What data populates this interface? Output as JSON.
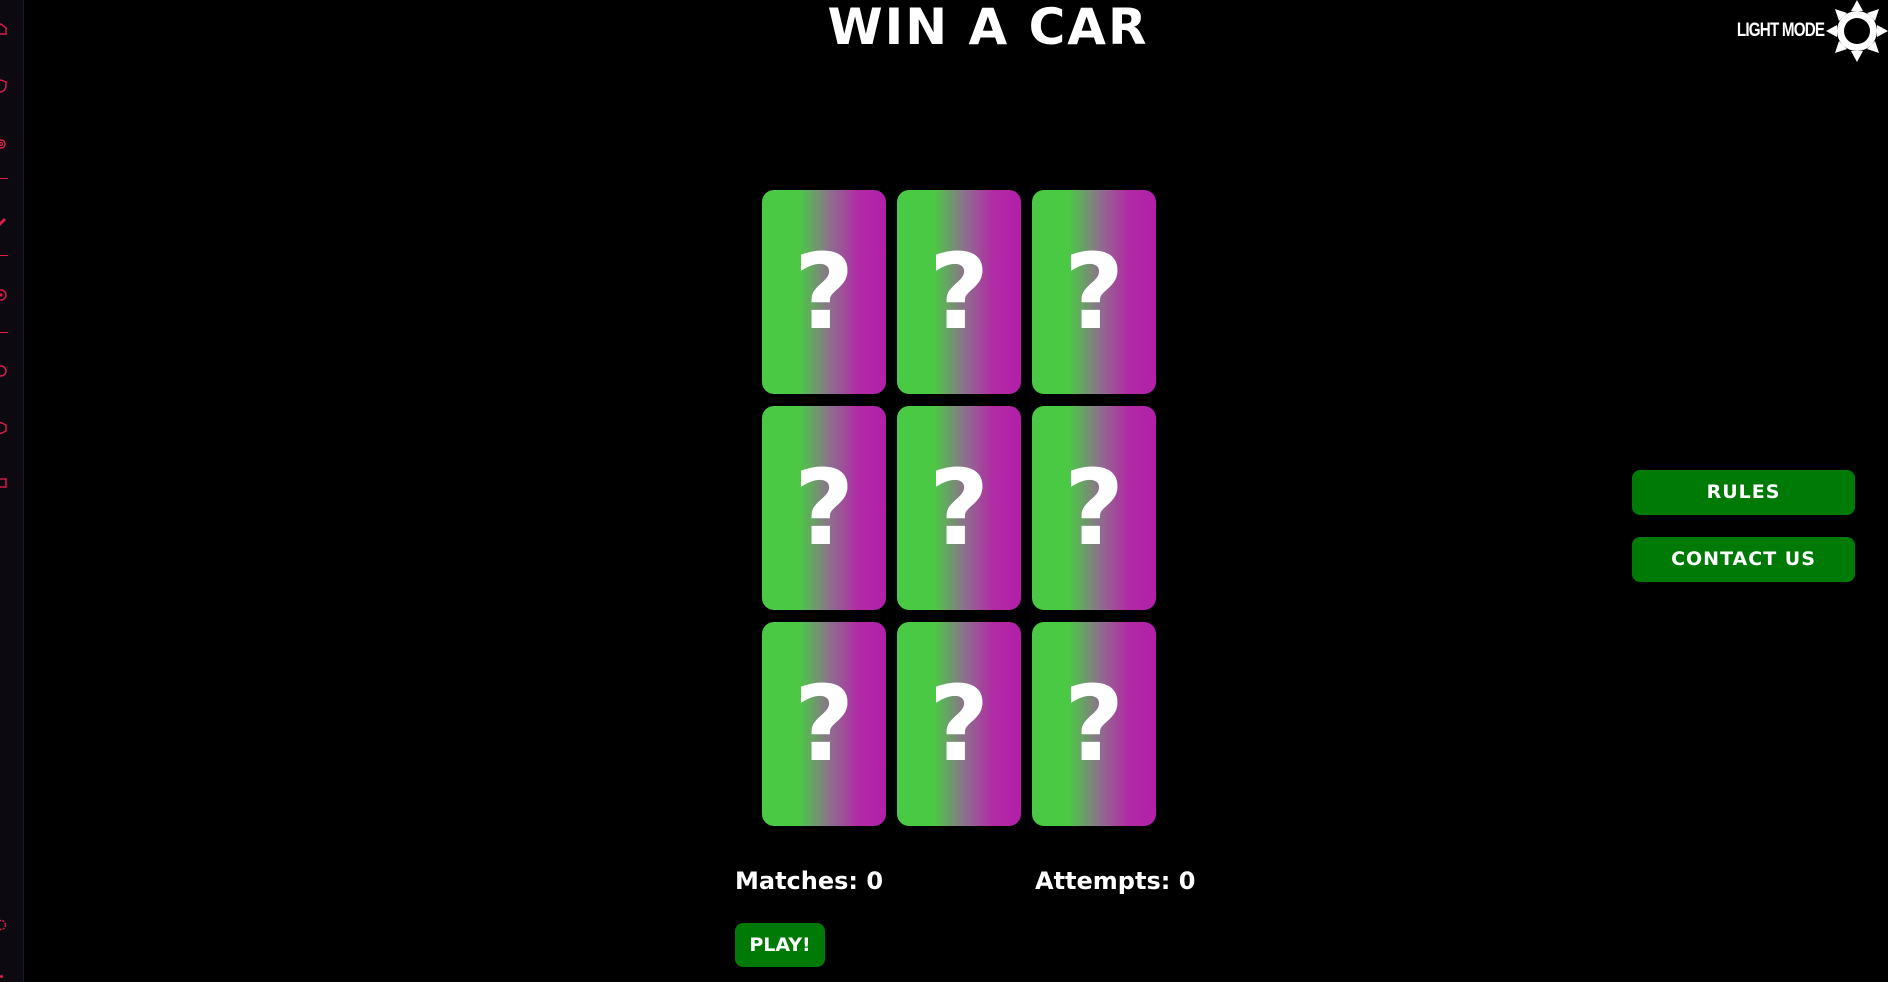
{
  "header": {
    "title": "WIN A CAR",
    "theme_toggle_label": "LIGHT MODE",
    "theme_icon": "sun-icon"
  },
  "sidebar": {
    "icons": [
      "home-icon",
      "shield-icon",
      "settings-icon",
      "pen-icon",
      "eye-icon",
      "clock-icon",
      "box-icon",
      "ticket-icon",
      "gear-icon"
    ],
    "accent_color": "#e01e4a"
  },
  "game": {
    "cards": [
      {
        "face": "?"
      },
      {
        "face": "?"
      },
      {
        "face": "?"
      },
      {
        "face": "?"
      },
      {
        "face": "?"
      },
      {
        "face": "?"
      },
      {
        "face": "?"
      },
      {
        "face": "?"
      },
      {
        "face": "?"
      }
    ],
    "card_gradient": [
      "#49c944",
      "#b21fa8"
    ],
    "matches_text": "Matches: 0",
    "attempts_text": "Attempts: 0",
    "play_label": "PLAY!"
  },
  "side_menu": {
    "rules_label": "RULES",
    "contact_label": "CONTACT US",
    "button_color": "#007a06"
  }
}
